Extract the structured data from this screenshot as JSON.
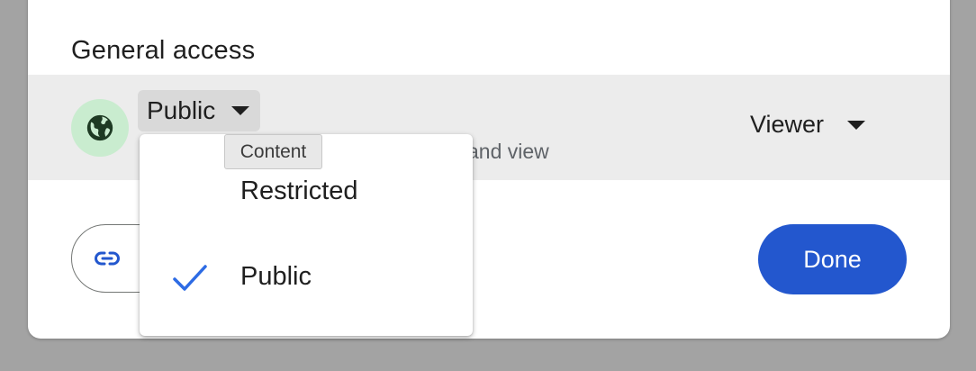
{
  "general_access": {
    "title": "General access",
    "access_level": "Public",
    "description_visible": "and view",
    "role": "Viewer",
    "globe_color": "#1e3a23",
    "globe_bg": "#c9eccf"
  },
  "tooltip": {
    "text": "Content"
  },
  "menu": {
    "items": [
      {
        "label": "Restricted",
        "selected": false
      },
      {
        "label": "Public",
        "selected": true
      }
    ],
    "check_color": "#2d6be4"
  },
  "actions": {
    "copy_link_icon": "link-icon",
    "done_label": "Done",
    "done_color": "#2357ce"
  }
}
